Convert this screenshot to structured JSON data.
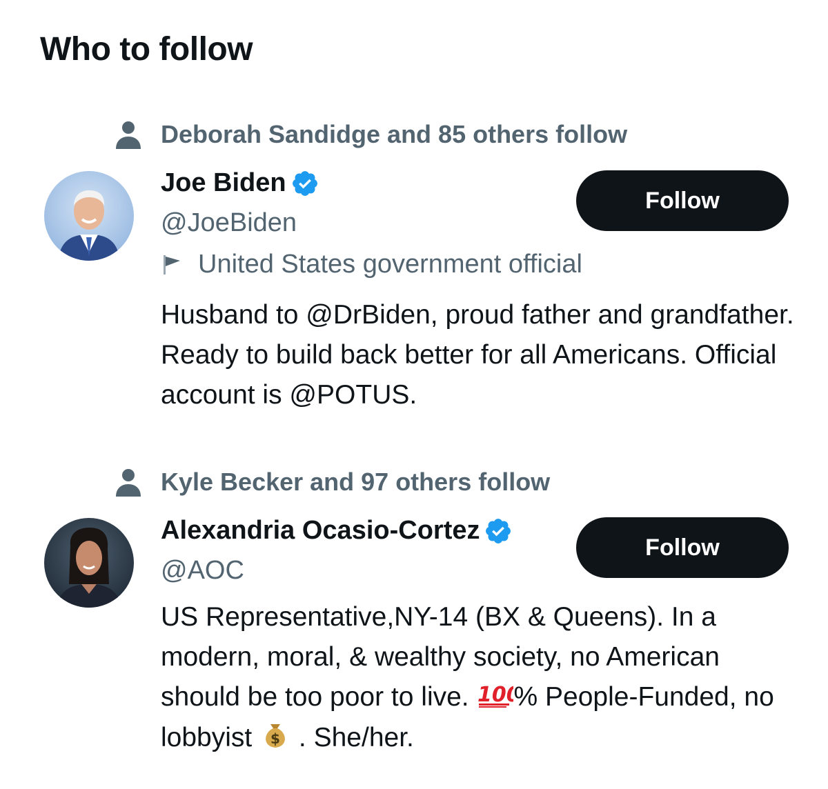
{
  "section": {
    "title": "Who to follow"
  },
  "accounts": [
    {
      "social_context": "Deborah Sandidge and 85 others follow",
      "name": "Joe Biden",
      "handle": "@JoeBiden",
      "label": "United States government official",
      "bio": "Husband to @DrBiden, proud father and grandfather. Ready to build back better for all Americans. Official account is @POTUS.",
      "follow_label": "Follow",
      "verified": true
    },
    {
      "social_context": "Kyle Becker and 97 others follow",
      "name": "Alexandria Ocasio-Cortez",
      "handle": "@AOC",
      "bio_part1": "US Representative,NY-14 (BX & Queens). In a modern, moral, & wealthy society, no American should be too poor to live.",
      "bio_part2": "%",
      "bio_part3": "People-Funded, no lobbyist",
      "bio_part4": ". She/her.",
      "follow_label": "Follow",
      "verified": true
    }
  ],
  "colors": {
    "text_primary": "#0f1419",
    "text_secondary": "#536471",
    "verified_blue": "#1d9bf0",
    "button_bg": "#0f1419",
    "hundred_red": "#e0202a",
    "money_bag": "#c99a3b"
  },
  "icons": [
    "person-icon",
    "verified-badge-icon",
    "flag-icon",
    "hundred-points-emoji",
    "money-bag-emoji"
  ]
}
